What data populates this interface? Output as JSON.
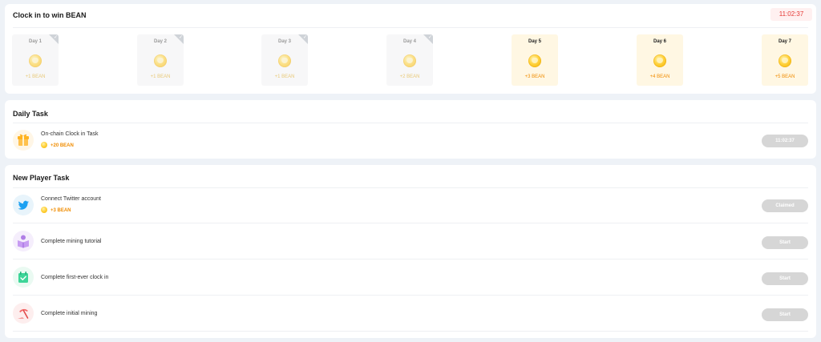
{
  "clockin": {
    "title": "Clock in to win BEAN",
    "timer": "11:02:37",
    "days": [
      {
        "label": "Day 1",
        "reward": "+1 BEAN",
        "claimed": true
      },
      {
        "label": "Day 2",
        "reward": "+1 BEAN",
        "claimed": true
      },
      {
        "label": "Day 3",
        "reward": "+1 BEAN",
        "claimed": true
      },
      {
        "label": "Day 4",
        "reward": "+2 BEAN",
        "claimed": true
      },
      {
        "label": "Day 5",
        "reward": "+3 BEAN",
        "claimed": false
      },
      {
        "label": "Day 6",
        "reward": "+4 BEAN",
        "claimed": false
      },
      {
        "label": "Day 7",
        "reward": "+5 BEAN",
        "claimed": false
      }
    ],
    "check_glyph": "✓",
    "coin_icon": "bean-coin-icon"
  },
  "daily": {
    "title": "Daily Task",
    "tasks": [
      {
        "name": "On-chain Clock in Task",
        "reward": "+20 BEAN",
        "button": "11:02:37",
        "icon": "gift-icon"
      }
    ]
  },
  "newplayer": {
    "title": "New Player Task",
    "tasks": [
      {
        "name": "Connect Twitter account",
        "reward": "+3 BEAN",
        "button": "Claimed",
        "icon": "twitter-icon"
      },
      {
        "name": "Complete mining tutorial",
        "reward": "",
        "button": "Start",
        "icon": "tutorial-book-icon"
      },
      {
        "name": "Complete first-ever clock in",
        "reward": "",
        "button": "Start",
        "icon": "calendar-check-icon"
      },
      {
        "name": "Complete initial mining",
        "reward": "",
        "button": "Start",
        "icon": "pickaxe-icon"
      }
    ]
  },
  "colors": {
    "accent": "#f08c00",
    "timer_red": "#e53935",
    "button_disabled": "#d6d6d6",
    "future_day_bg": "#fff7e3",
    "past_day_bg": "#f7f7f8"
  }
}
